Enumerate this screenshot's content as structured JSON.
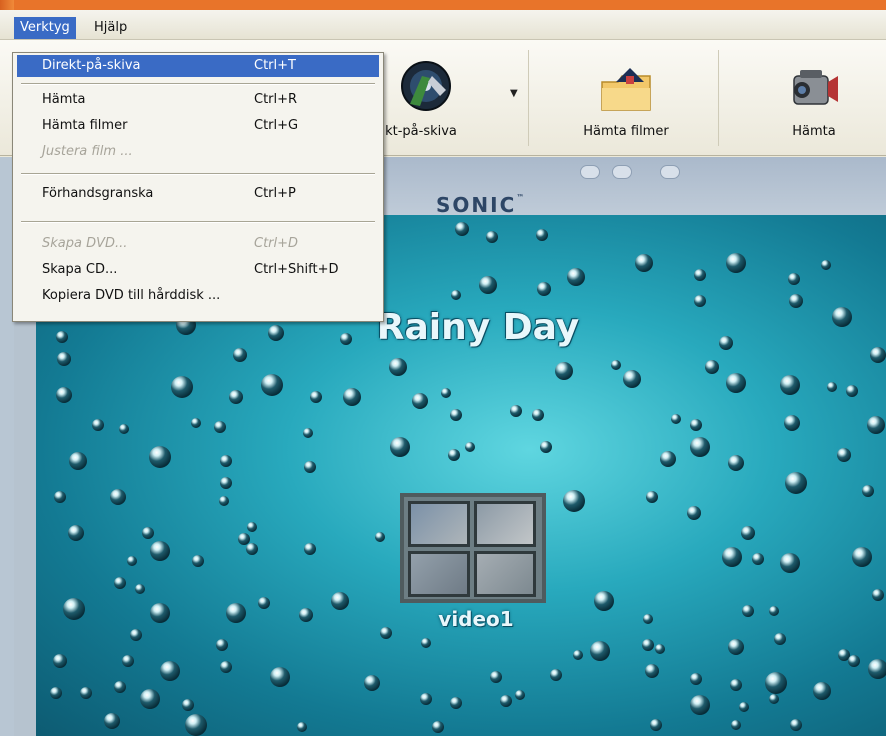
{
  "menubar": {
    "items": [
      {
        "label": "Verktyg",
        "active": true
      },
      {
        "label": "Hjälp",
        "active": false
      }
    ]
  },
  "dropdown": {
    "items": [
      {
        "label": "Direkt-på-skiva",
        "shortcut": "Ctrl+T",
        "state": "highlighted"
      },
      {
        "label": "Hämta",
        "shortcut": "Ctrl+R",
        "state": "normal"
      },
      {
        "label": "Hämta filmer",
        "shortcut": "Ctrl+G",
        "state": "normal"
      },
      {
        "label": "Justera film ...",
        "shortcut": "",
        "state": "disabled"
      },
      {
        "label": "Förhandsgranska",
        "shortcut": "Ctrl+P",
        "state": "normal"
      },
      {
        "label": "Skapa DVD...",
        "shortcut": "Ctrl+D",
        "state": "disabled"
      },
      {
        "label": "Skapa CD...",
        "shortcut": "Ctrl+Shift+D",
        "state": "normal"
      },
      {
        "label": "Kopiera DVD till hårddisk ...",
        "shortcut": "",
        "state": "normal"
      }
    ]
  },
  "toolbar": {
    "buttons": [
      {
        "label": "kt-på-skiva",
        "icon": "direct-to-disc-icon"
      },
      {
        "label": "Hämta filmer",
        "icon": "folder-icon"
      },
      {
        "label": "Hämta",
        "icon": "camcorder-icon"
      }
    ]
  },
  "preview": {
    "brand": "SONIC",
    "brand_tm": "™",
    "disc_title": "Rainy Day",
    "thumbnail_label": "video1"
  },
  "colors": {
    "accent": "#3a6bc5",
    "frame": "#e8742a",
    "preview_bg": "#28a9bd"
  }
}
